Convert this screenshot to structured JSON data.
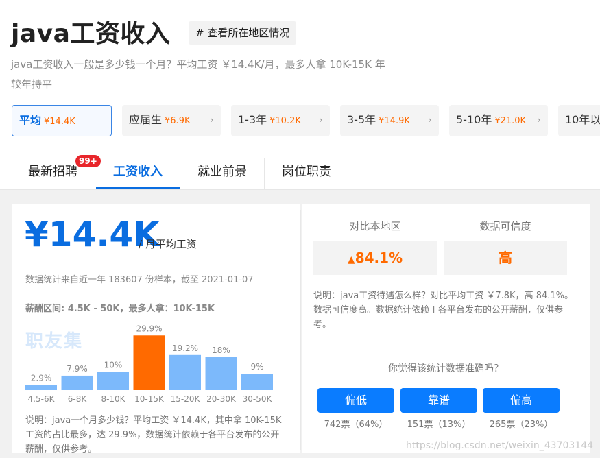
{
  "header": {
    "title": "java工资收入",
    "region_button": "# 查看所在地区情况",
    "subtitle": "java工资收入一般是多少钱一个月？平均工资 ￥14.4K/月，最多人拿 10K-15K 年较年持平"
  },
  "experience_tabs": [
    {
      "label": "平均",
      "amount": "¥14.4K",
      "active": true
    },
    {
      "label": "应届生",
      "amount": "¥6.9K",
      "active": false
    },
    {
      "label": "1-3年",
      "amount": "¥10.2K",
      "active": false
    },
    {
      "label": "3-5年",
      "amount": "¥14.9K",
      "active": false
    },
    {
      "label": "5-10年",
      "amount": "¥21.0K",
      "active": false
    },
    {
      "label": "10年以",
      "amount": "",
      "active": false
    }
  ],
  "section_tabs": [
    {
      "label": "最新招聘",
      "badge": "99+"
    },
    {
      "label": "工资收入",
      "active": true
    },
    {
      "label": "就业前景"
    },
    {
      "label": "岗位职责"
    }
  ],
  "salary": {
    "big": "¥14.4K",
    "unit": "/ 月平均工资",
    "stat_note": "数据统计来自近一年 183607 份样本，截至 2021-01-07",
    "range": "薪酬区间: 4.5K - 50K，最多人拿：10K-15K",
    "logo_text": "职友集",
    "note": "说明：java一个月多少钱？平均工资 ￥14.4K，其中拿 10K-15K 工资的占比最多，达 29.9%，数据统计依赖于各平台发布的公开薪酬，仅供参考。"
  },
  "chart_data": {
    "type": "bar",
    "categories": [
      "4.5-6K",
      "6-8K",
      "8-10K",
      "10-15K",
      "15-20K",
      "20-30K",
      "30-50K"
    ],
    "values": [
      2.9,
      7.9,
      10,
      29.9,
      19.2,
      18,
      9
    ],
    "value_labels": [
      "2.9%",
      "7.9%",
      "10%",
      "29.9%",
      "19.2%",
      "18%",
      "9%"
    ],
    "highlight_index": 3,
    "colors": {
      "normal": "#7cb9fb",
      "highlight": "#ff6a00"
    }
  },
  "compare": {
    "head_left": "对比本地区",
    "head_right": "数据可信度",
    "value_left": "84.1%",
    "value_right": "高",
    "note": "说明：java工资待遇怎么样？对比平均工资 ￥7.8K，高 84.1%。数据可信度高。数据统计依赖于各平台发布的公开薪酬，仅供参考。",
    "question": "你觉得该统计数据准确吗？",
    "votes": [
      {
        "label": "偏低",
        "count": "742票（64%）"
      },
      {
        "label": "靠谱",
        "count": "151票（13%）"
      },
      {
        "label": "偏高",
        "count": "265票（23%）"
      }
    ]
  },
  "footer_watermark": "https://blog.csdn.net/weixin_43703144",
  "colors": {
    "accent": "#0a6de0",
    "highlight": "#ff6a00"
  }
}
